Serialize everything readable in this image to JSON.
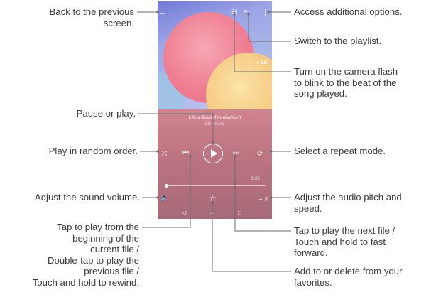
{
  "player": {
    "song_title": "Life's Good (Frombathon)",
    "song_artist": "LG Sound",
    "duration": "2:25",
    "brand": "LG",
    "icons": [
      "back-icon",
      "flash-icon",
      "playlist-icon",
      "more-options-icon",
      "shuffle-icon",
      "previous-icon",
      "play-icon",
      "next-icon",
      "repeat-icon",
      "volume-icon",
      "audio-pitch-icon",
      "favorite-icon"
    ]
  },
  "callouts": {
    "back": "Back to the previous\nscreen.",
    "options": "Access additional options.",
    "playlist": "Switch to the playlist.",
    "flash": "Turn on the camera flash\nto blink to the beat of the\nsong played.",
    "pause": "Pause or play.",
    "shuffle": "Play in random order.",
    "repeat": "Select a repeat mode.",
    "volume": "Adjust the sound volume.",
    "pitch": "Adjust the audio pitch and\nspeed.",
    "previous": "Tap to play from the\nbeginning of the\ncurrent file /\nDouble-tap to play the\nprevious file /\nTouch and hold to rewind.",
    "next": "Tap to play the next file /\nTouch and hold to fast\nforward.",
    "favorite": "Add to or delete from your\nfavorites."
  },
  "colors": {
    "leader": "#6b6b6b",
    "text": "#3b3b3b"
  }
}
